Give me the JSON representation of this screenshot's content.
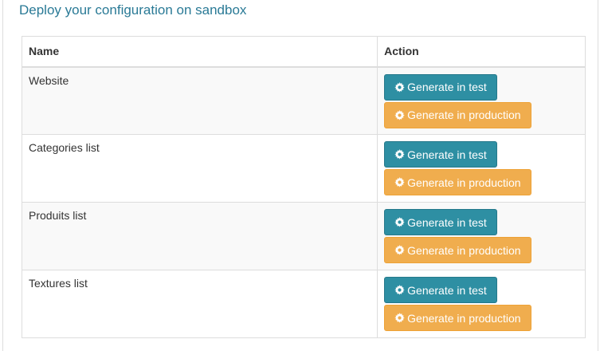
{
  "panel": {
    "title": "Deploy your configuration on sandbox"
  },
  "table": {
    "headers": {
      "name": "Name",
      "action": "Action"
    },
    "rows": [
      {
        "name": "Website",
        "test_label": "Generate in test",
        "prod_label": "Generate in production"
      },
      {
        "name": "Categories list",
        "test_label": "Generate in test",
        "prod_label": "Generate in production"
      },
      {
        "name": "Produits list",
        "test_label": "Generate in test",
        "prod_label": "Generate in production"
      },
      {
        "name": "Textures list",
        "test_label": "Generate in test",
        "prod_label": "Generate in production"
      }
    ]
  },
  "icons": {
    "button_icon": "gear-icon"
  },
  "colors": {
    "title": "#2a7a96",
    "test_button": "#2e8fa3",
    "production_button": "#f0ad4e"
  }
}
